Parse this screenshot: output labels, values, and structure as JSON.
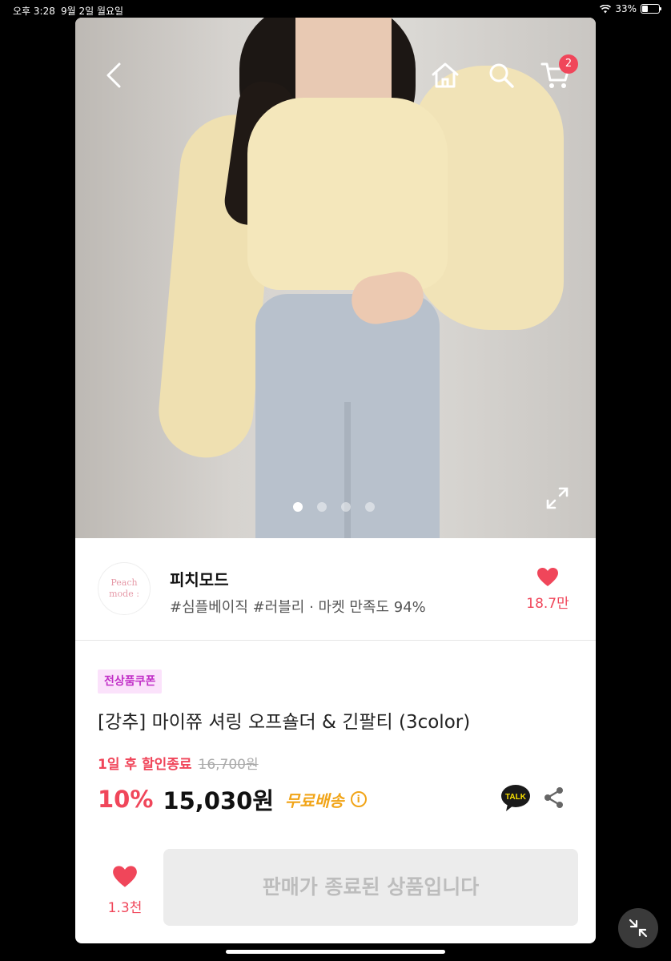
{
  "status_bar": {
    "time": "오후 3:28",
    "date": "9월 2일 월요일",
    "battery": "33%",
    "battery_level": 0.33
  },
  "header": {
    "back_icon": "chevron-left-icon",
    "home_icon": "home-icon",
    "search_icon": "search-icon",
    "cart_icon": "cart-icon",
    "cart_count": "2"
  },
  "carousel": {
    "image_count": 4,
    "active_index": 0,
    "expand_icon": "expand-icon"
  },
  "seller": {
    "logo_text_line1": "Peach",
    "logo_text_line2": "mode :",
    "name": "피치모드",
    "tags": "#심플베이직 #러블리 · 마켓 만족도 94%",
    "favorite_count": "18.7만"
  },
  "product": {
    "coupon_badge": "전상품쿠폰",
    "title": "[강추] 마이쮸 셔링 오프숄더 & 긴팔티 (3color)",
    "deal_ending": "1일 후 할인종료",
    "original_price": "16,700원",
    "discount_percent": "10%",
    "price": "15,030원",
    "shipping": "무료배송",
    "talk_label": "TALK"
  },
  "bottom_bar": {
    "favorite_count": "1.3천",
    "sold_out_label": "판매가 종료된 상품입니다"
  },
  "colors": {
    "accent": "#f0465a",
    "shipping": "#f1a417",
    "coupon_bg": "#fbe2fb",
    "coupon_text": "#c12fc7"
  }
}
